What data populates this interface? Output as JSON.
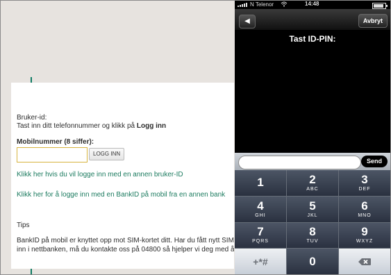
{
  "left_page": {
    "user_id_label": "Bruker-id:",
    "instruction": "Tast inn ditt telefonnummer og klikk på",
    "instruction_bold": "Logg inn",
    "mobile_label": "Mobilnummer (8 siffer):",
    "mobile_value": "",
    "login_button": "LOGG INN",
    "link1": "Klikk her hvis du vil logge inn med en annen bruker-ID",
    "link2": "Klikk her for å logge inn med en BankID på mobil fra en annen bank",
    "tips_title": "Tips",
    "tips_line1": "BankID på mobil er knyttet opp mot SIM-kortet ditt. Har du fått nytt SIM",
    "tips_line2": "inn i nettbanken, må du kontakte oss på 04800 så hjelper vi deg med å"
  },
  "phone": {
    "status": {
      "carrier": "N Telenor",
      "time": "14:48"
    },
    "back_label": "◀",
    "cancel_label": "Avbryt",
    "title": "Tast ID-PIN:",
    "pin_value": "",
    "send_label": "Send",
    "keys": [
      {
        "num": "1",
        "sub": ""
      },
      {
        "num": "2",
        "sub": "ABC"
      },
      {
        "num": "3",
        "sub": "DEF"
      },
      {
        "num": "4",
        "sub": "GHI"
      },
      {
        "num": "5",
        "sub": "JKL"
      },
      {
        "num": "6",
        "sub": "MNO"
      },
      {
        "num": "7",
        "sub": "PQRS"
      },
      {
        "num": "8",
        "sub": "TUV"
      },
      {
        "num": "9",
        "sub": "WXYZ"
      },
      {
        "num": "+*#",
        "sub": ""
      },
      {
        "num": "0",
        "sub": ""
      },
      {
        "num": "",
        "sub": ""
      }
    ],
    "icons": {
      "backspace": "backspace-icon",
      "back": "back-arrow-icon",
      "wifi": "wifi-icon"
    }
  }
}
